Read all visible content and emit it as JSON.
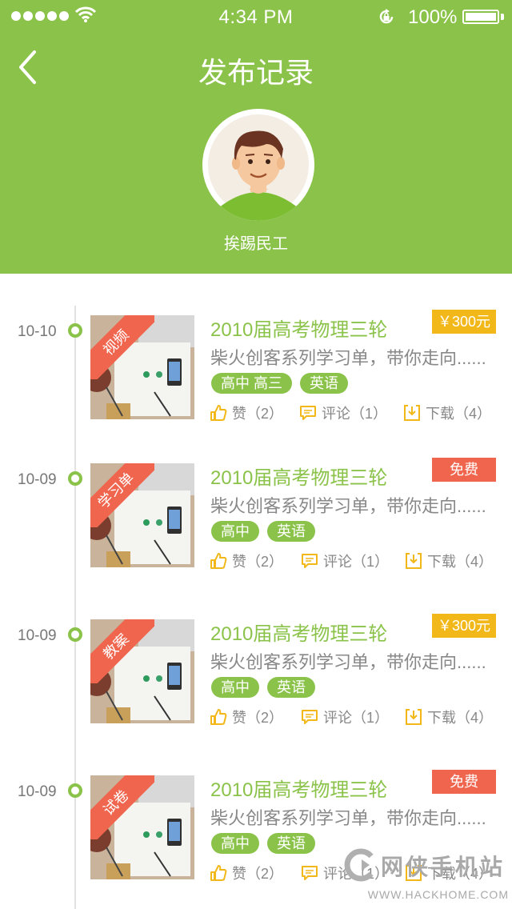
{
  "status_bar": {
    "time": "4:34 PM",
    "battery": "100%"
  },
  "nav": {
    "title": "发布记录"
  },
  "profile": {
    "username": "挨踢民工"
  },
  "colors": {
    "brand": "#8bc34a",
    "price_paid": "#f2b81a",
    "price_free": "#f0654e"
  },
  "records": [
    {
      "date": "10-10",
      "badge": "视频",
      "title": "2010届高考物理三轮",
      "price": "￥300元",
      "price_type": "paid",
      "desc": "柴火创客系列学习单，带你走向......",
      "tags": [
        "高中 高三",
        "英语"
      ],
      "likes": "赞（2）",
      "comments": "评论（1）",
      "downloads": "下载（4）"
    },
    {
      "date": "10-09",
      "badge": "学习单",
      "title": "2010届高考物理三轮",
      "price": "免费",
      "price_type": "free",
      "desc": "柴火创客系列学习单，带你走向......",
      "tags": [
        "高中",
        "英语"
      ],
      "likes": "赞（2）",
      "comments": "评论（1）",
      "downloads": "下载（4）"
    },
    {
      "date": "10-09",
      "badge": "教案",
      "title": "2010届高考物理三轮",
      "price": "￥300元",
      "price_type": "paid",
      "desc": "柴火创客系列学习单，带你走向......",
      "tags": [
        "高中",
        "英语"
      ],
      "likes": "赞（2）",
      "comments": "评论（1）",
      "downloads": "下载（4）"
    },
    {
      "date": "10-09",
      "badge": "试卷",
      "title": "2010届高考物理三轮",
      "price": "免费",
      "price_type": "free",
      "desc": "柴火创客系列学习单，带你走向......",
      "tags": [
        "高中",
        "英语"
      ],
      "likes": "赞（2）",
      "comments": "评论（1）",
      "downloads": "下载（4）"
    }
  ],
  "watermark": {
    "name": "网侠手机站",
    "url": "WWW.HACKHOME.COM"
  }
}
